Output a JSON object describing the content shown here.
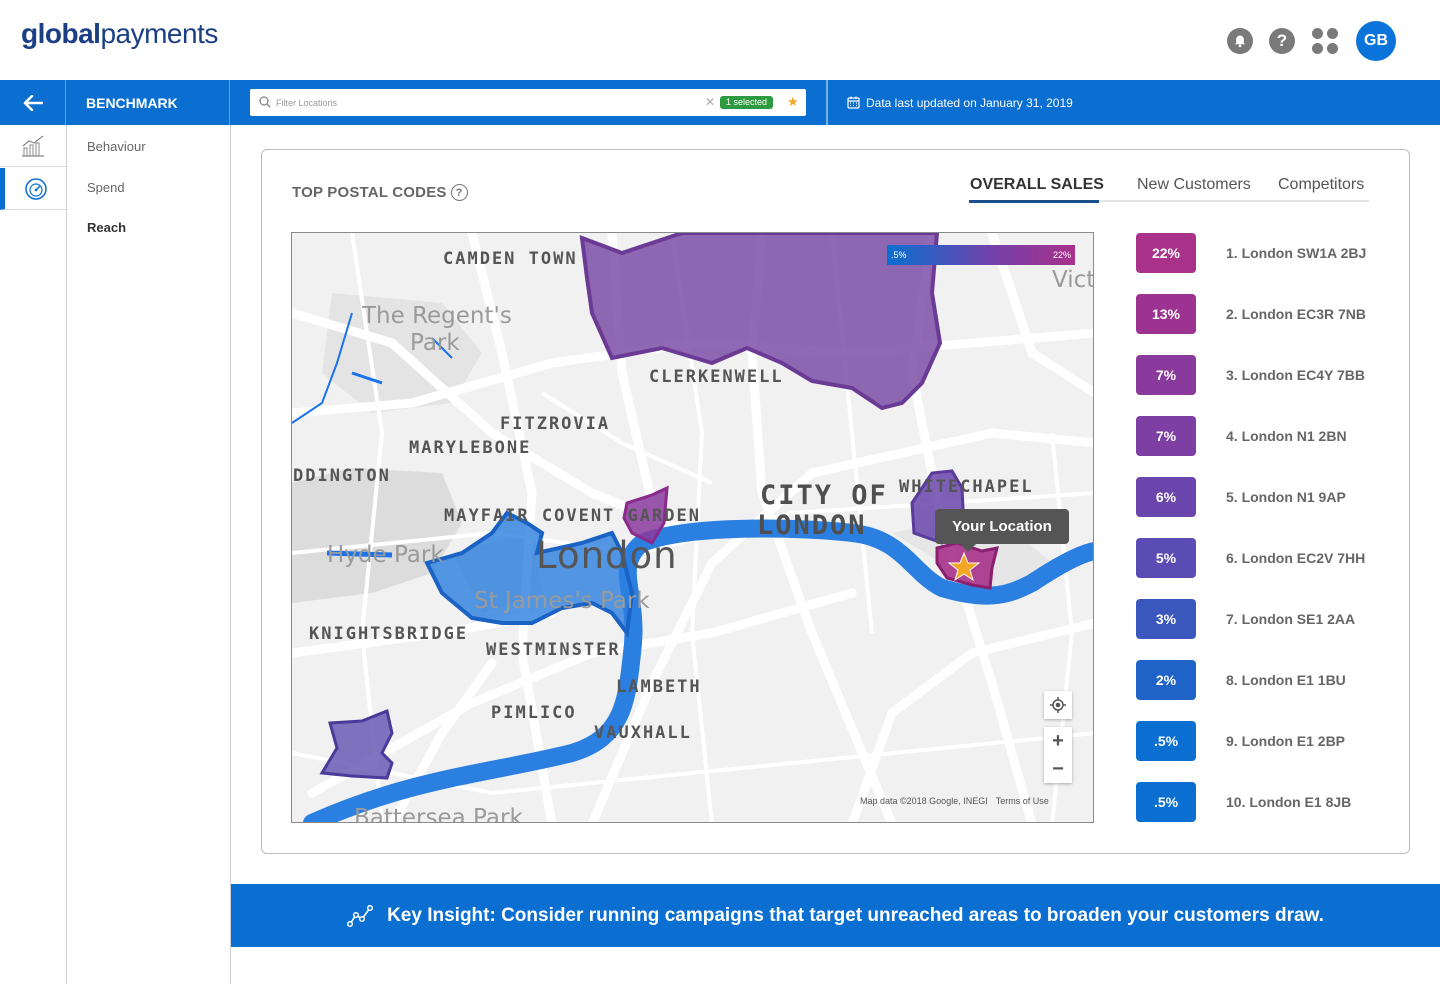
{
  "header": {
    "logo_bold": "global",
    "logo_regular": "payments",
    "avatar_initials": "GB"
  },
  "nav": {
    "title": "BENCHMARK",
    "filter_placeholder": "Filter Locations",
    "selected_badge": "1 selected",
    "updated_text": "Data last updated on January 31, 2019"
  },
  "sidebar": {
    "items": [
      {
        "label": "Behaviour",
        "icon": "bar-chart-icon"
      },
      {
        "label": "Spend",
        "icon": "gauge-icon"
      },
      {
        "label": "Reach",
        "active": true
      }
    ]
  },
  "card": {
    "title": "TOP POSTAL CODES",
    "tabs": [
      {
        "label": "OVERALL SALES",
        "active": true
      },
      {
        "label": "New Customers"
      },
      {
        "label": "Competitors"
      }
    ]
  },
  "map": {
    "legend_min": ".5%",
    "legend_max": "22%",
    "labels": {
      "camden": "CAMDEN TOWN",
      "regents": "The Regent's",
      "regents2": "Park",
      "clerkenwell": "CLERKENWELL",
      "fitzrovia": "FITZROVIA",
      "marylebone": "MARYLEBONE",
      "paddington": "DDINGTON",
      "mayfair": "MAYFAIR COVENT GARDEN",
      "city1": "CITY OF",
      "city2": "LONDON",
      "whitechapel": "WHITECHAPEL",
      "hydepark": "Hyde Park",
      "london": "London",
      "stjames": "St James's Park",
      "knightsbridge": "KNIGHTSBRIDGE",
      "westminster": "WESTMINSTER",
      "lambeth": "LAMBETH",
      "pimlico": "PIMLICO",
      "vauxhall": "VAUXHALL",
      "victoria": "Vict",
      "battersea": "Battersea Park"
    },
    "tooltip": "Your Location",
    "attribution": "Map data ©2018 Google, INEGI",
    "terms": "Terms of Use"
  },
  "ranking": [
    {
      "pct": "22%",
      "name": "1. London SW1A 2BJ",
      "color": "#a8318a"
    },
    {
      "pct": "13%",
      "name": "2. London EC3R 7NB",
      "color": "#9c3390"
    },
    {
      "pct": "7%",
      "name": "3. London EC4Y 7BB",
      "color": "#8a3a9c"
    },
    {
      "pct": "7%",
      "name": "4. London N1 2BN",
      "color": "#7d3fa3"
    },
    {
      "pct": "6%",
      "name": "5. London N1 9AP",
      "color": "#6a45ab"
    },
    {
      "pct": "5%",
      "name": "6. London EC2V 7HH",
      "color": "#5a4cb2"
    },
    {
      "pct": "3%",
      "name": "7. London SE1 2AA",
      "color": "#3a57bd"
    },
    {
      "pct": "2%",
      "name": "8. London E1 1BU",
      "color": "#1f63c8"
    },
    {
      "pct": ".5%",
      "name": "9. London E1 2BP",
      "color": "#0a6fd1"
    },
    {
      "pct": ".5%",
      "name": "10. London E1 8JB",
      "color": "#0a6fd1"
    }
  ],
  "insight": {
    "text": "Key Insight: Consider running campaigns that target unreached areas to broaden your customers draw."
  }
}
